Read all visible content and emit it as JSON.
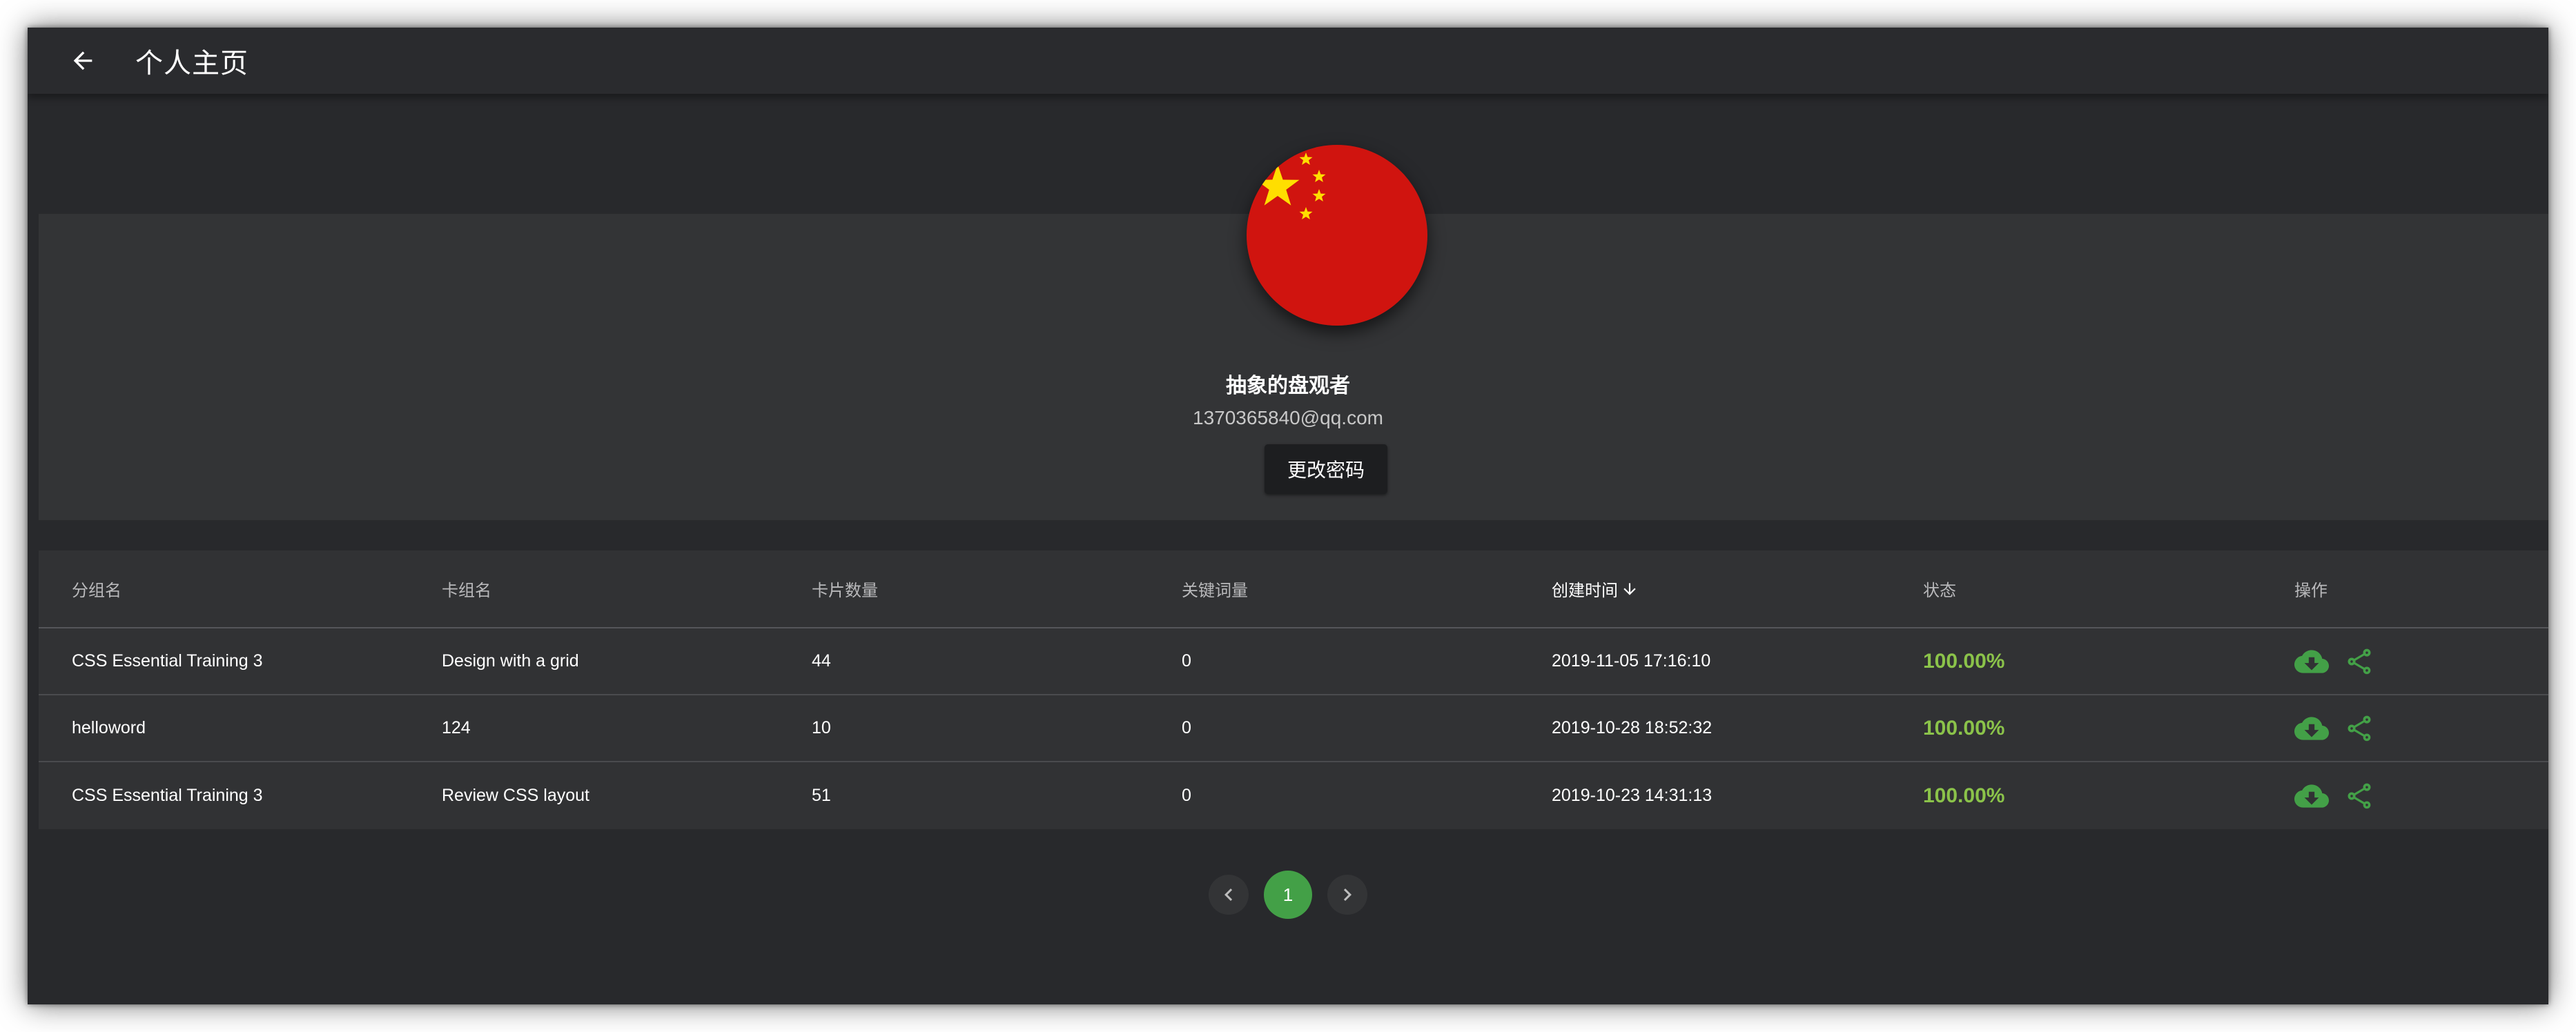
{
  "appbar": {
    "title": "个人主页",
    "back_icon": "arrow-left-icon"
  },
  "profile": {
    "avatar_icon": "china-flag-avatar",
    "username": "抽象的盘观者",
    "email": "1370365840@qq.com",
    "change_password_label": "更改密码"
  },
  "table": {
    "headers": [
      "分组名",
      "卡组名",
      "卡片数量",
      "关键词量",
      "创建时间",
      "状态",
      "操作"
    ],
    "sorted_column_icon": "arrow-down-icon",
    "rows": [
      {
        "group": "CSS Essential Training 3",
        "deck": "Design with a grid",
        "cards": "44",
        "keywords": "0",
        "created": "2019-11-05 17:16:10",
        "status": "100.00%"
      },
      {
        "group": "helloword",
        "deck": "124",
        "cards": "10",
        "keywords": "0",
        "created": "2019-10-28 18:52:32",
        "status": "100.00%"
      },
      {
        "group": "CSS Essential Training 3",
        "deck": "Review CSS layout",
        "cards": "51",
        "keywords": "0",
        "created": "2019-10-23 14:31:13",
        "status": "100.00%"
      }
    ],
    "action_icons": [
      "cloud-download-icon",
      "share-icon"
    ]
  },
  "pagination": {
    "current_page": "1",
    "prev_icon": "chevron-left-icon",
    "next_icon": "chevron-right-icon"
  },
  "colors": {
    "background": "#28292c",
    "panel": "#333436",
    "accent_green": "#43a047",
    "status_green": "#8bc34a",
    "flag_red": "#d0140f",
    "flag_yellow": "#ffde00"
  }
}
